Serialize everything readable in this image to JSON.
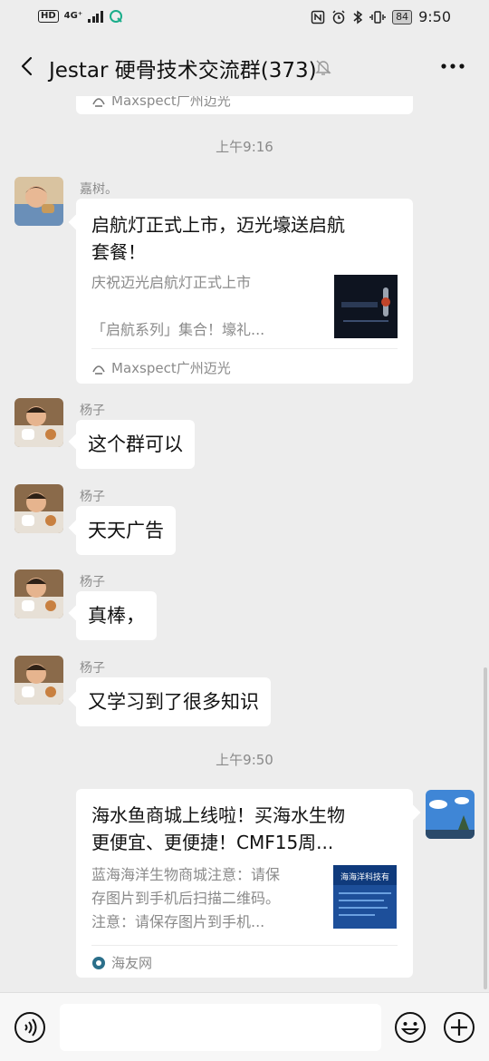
{
  "status_bar": {
    "left_badge": "HD",
    "network": "4G⁺",
    "battery": "84",
    "time": "9:50"
  },
  "header": {
    "title": "Jestar 硬骨技术交流群(373)"
  },
  "chat": {
    "top_card_source": "Maxspect广州迈光",
    "timestamp_1": "上午9:16",
    "msg_jiashu": {
      "sender": "嘉树。",
      "card_title_line1": "启航灯正式上市，迈光壕送启航",
      "card_title_line2": "套餐！",
      "card_desc_line1": "庆祝迈光启航灯正式上市",
      "card_desc_line2": "「启航系列」集合！壕礼...",
      "card_source": "Maxspect广州迈光"
    },
    "msg_yangzi_1": {
      "sender": "杨子",
      "text": "这个群可以"
    },
    "msg_yangzi_2": {
      "sender": "杨子",
      "text": "天天广告"
    },
    "msg_yangzi_3": {
      "sender": "杨子",
      "text": "真棒，"
    },
    "msg_yangzi_4": {
      "sender": "杨子",
      "text": "又学习到了很多知识"
    },
    "timestamp_2": "上午9:50",
    "msg_self_card": {
      "card_title_line1": "海水鱼商城上线啦！买海水生物",
      "card_title_line2": "更便宜、更便捷！CMF15周...",
      "card_desc_line1": "蓝海海洋生物商城注意：请保",
      "card_desc_line2": "存图片到手机后扫描二维码。",
      "card_desc_line3": "注意：请保存图片到手机...",
      "thumb_text": "海海洋科技有",
      "card_source": "海友网"
    }
  },
  "input_bar": {
    "placeholder": ""
  },
  "colors": {
    "background": "#ededed",
    "bubble": "#ffffff",
    "meta_text": "#8a8a8a"
  }
}
